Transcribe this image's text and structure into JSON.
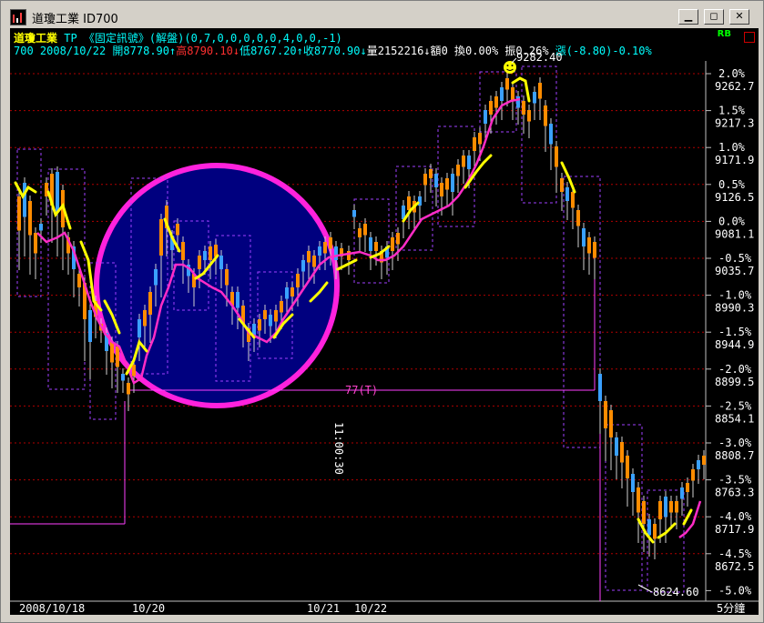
{
  "window": {
    "title": "道瓊工業 ID700",
    "buttons": {
      "minimize": "▁",
      "restore": "◻",
      "close": "✕"
    }
  },
  "header": {
    "name": "道瓊工業",
    "settings": "TP 《固定訊號》(解盤)(0,7,0,0,0,0,0,4,0,0,-1)",
    "id": "700",
    "date": "2008/10/22",
    "open_label": "開",
    "open": "8778.90",
    "high_label": "高",
    "high": "8790.10",
    "low_label": "低",
    "low": "8767.20",
    "close_label": "收",
    "close": "8770.90",
    "volume_label": "量",
    "volume": "2152216",
    "amount_label": "額",
    "amount": "0",
    "turnover_label": "換",
    "turnover": "0.00%",
    "amplitude_label": "振",
    "amplitude": "0.26%",
    "change_label": "漲",
    "change": "(-8.80)-0.10%",
    "rb": "RB"
  },
  "axis": {
    "right_labels": [
      {
        "pct": "2.0%",
        "price": "9262.7"
      },
      {
        "pct": "1.5%",
        "price": "9217.3"
      },
      {
        "pct": "1.0%",
        "price": "9171.9"
      },
      {
        "pct": "0.5%",
        "price": "9126.5"
      },
      {
        "pct": "0.0%",
        "price": "9081.1"
      },
      {
        "pct": "-0.5%",
        "price": "9035.7"
      },
      {
        "pct": "-1.0%",
        "price": "8990.3"
      },
      {
        "pct": "-1.5%",
        "price": "8944.9"
      },
      {
        "pct": "-2.0%",
        "price": "8899.5"
      },
      {
        "pct": "-2.5%",
        "price": "8854.1"
      },
      {
        "pct": "-3.0%",
        "price": "8808.7"
      },
      {
        "pct": "-3.5%",
        "price": "8763.3"
      },
      {
        "pct": "-4.0%",
        "price": "8717.9"
      },
      {
        "pct": "-4.5%",
        "price": "8672.5"
      },
      {
        "pct": "-5.0%",
        "price": "8624.60"
      }
    ],
    "bottom_labels": [
      "2008/10/18",
      "10/20",
      "10/21",
      "10/22"
    ],
    "period": "5分鐘"
  },
  "annotations": {
    "high_marker": "9282.40",
    "low_marker": "8624.60",
    "line_label": "77(T)",
    "time_text": "11:00:30"
  },
  "colors": {
    "up": "#ff8c00",
    "down": "#3aa0ff",
    "ma_pink": "#ff2cc6",
    "ma_yellow": "#ffff00",
    "grid": "#c00000",
    "axis_text": "#ffffff",
    "circle_fill": "#00007f",
    "circle_stroke": "#ff22dd"
  }
}
